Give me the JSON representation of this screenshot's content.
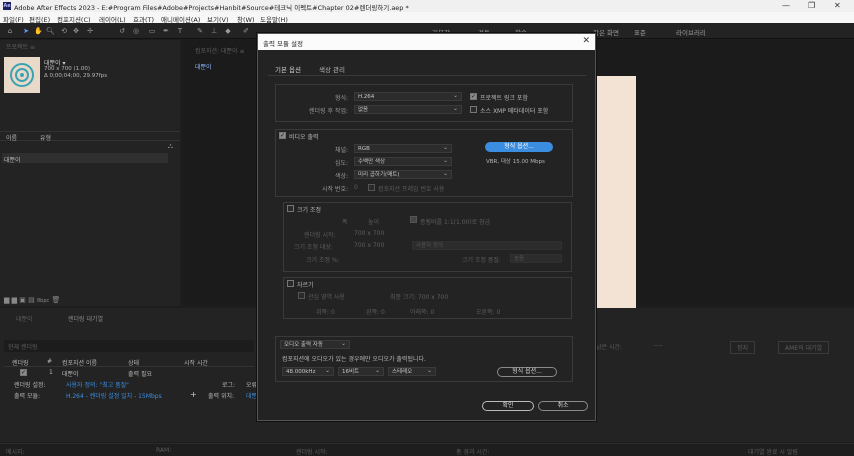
{
  "window": {
    "logo": "Ae",
    "title": "Adobe After Effects 2023 - E:#Program Files#Adobe#Projects#Hanbit#Source#테크닉 이펙트#Chapter 02#렌더링하기.aep *",
    "minimize": "—",
    "restore": "❐",
    "close": "✕"
  },
  "menu": [
    "파일(F)",
    "편집(E)",
    "컴포지션(C)",
    "레이어(L)",
    "효과(T)",
    "애니메이션(A)",
    "보기(V)",
    "창(W)",
    "도움말(H)"
  ],
  "workspaces": [
    "기본값",
    "검토",
    "학습",
    "작은 화면",
    "표준",
    "라이브러리"
  ],
  "project": {
    "header": "프로젝트 ≡",
    "comp_name": "대뿐이 ▾",
    "comp_size": "700 x 700 (1.00)",
    "comp_dur": "Δ 0;00;04;00, 29.97fps",
    "col_name": "이름",
    "col_type": "유형",
    "item": "대뿐이",
    "footer_bpc": "8bpc"
  },
  "comp_panel": {
    "header": "컴포지션: 대뿐이 ≡",
    "tab": "대뿐이"
  },
  "right_panel": {
    "estimate_label": "남은 시간:",
    "estimate_value": "----",
    "stop_btn": "정지",
    "queue_btn": "AME의 대기열"
  },
  "timeline": {
    "tab1": "대뿐이",
    "tab2": "렌더링 대기열",
    "search_label": "현재 렌더링",
    "col_render": "렌더링",
    "col_num": "#",
    "col_name": "컴포지션 이름",
    "col_status": "상태",
    "col_start": "시작 시간",
    "row_num": "1",
    "row_name": "대뿐이",
    "row_status": "출력 필요",
    "render_settings_label": "렌더링 설정:",
    "render_settings_value": "사용자 정의: \"최고 품질\"",
    "output_module_label": "출력 모듈:",
    "output_module_value": "H.264 - 렌더링 설정 일치 - 15Mbps",
    "log_label": "로그:",
    "log_value": "오류",
    "output_to_label": "출력 위치:",
    "output_to_value": "대뿐이"
  },
  "status_bar": {
    "messages": "메시지:",
    "ram": "RAM:",
    "renders_started": "렌더링 시작:",
    "total_time": "총 경과 시간:",
    "notify": "대기열 완료 시 알림"
  },
  "dialog": {
    "title": "출력 모듈 설정",
    "tabs": [
      "기본 옵션",
      "색상 관리"
    ],
    "format_label": "형식:",
    "format_value": "H.264",
    "post_render_label": "렌더링 후 작업:",
    "post_render_value": "없음",
    "include_project_link": "프로젝트 링크 포함",
    "include_xmp": "소스 XMP 메타데이터 포함",
    "video_output": "비디오 출력",
    "channels_label": "채널:",
    "channels_value": "RGB",
    "depth_label": "심도:",
    "depth_value": "수백만 색상",
    "color_label": "색상:",
    "color_value": "미리 곱하기(매트)",
    "start_label": "시작 번호:",
    "start_value": "0",
    "use_comp_frame": "컴포지션 프레임 번호 사용",
    "format_options_btn": "형식 옵션...",
    "format_info": "VBR, 대상 15.00 Mbps",
    "resize": "크기 조정",
    "resize_width": "폭",
    "resize_height": "높이",
    "lock_ratio": "종횡비를 1:1(1.00)로 잠금",
    "rendering_at_label": "렌더링 시작:",
    "rendering_at_value": "700 x 700",
    "resize_to_label": "크기 조정 대상:",
    "resize_to_value": "700 x 700",
    "resize_preset": "사용자 정의",
    "resize_pct_label": "크기 조정 %:",
    "resize_quality_label": "크기 조정 품질:",
    "resize_quality_value": "높음",
    "crop": "자르기",
    "use_roi": "관심 영역 사용",
    "final_size_label": "최종 크기: 700 x 700",
    "crop_top": "위쪽: 0",
    "crop_left": "왼쪽: 0",
    "crop_bottom": "아래쪽: 0",
    "crop_right": "오른쪽: 0",
    "audio_output": "오디오 출력 자동",
    "audio_note": "컴포지션에 오디오가 있는 경우에만 오디오가 출력됩니다.",
    "audio_rate": "48.000kHz",
    "audio_bits": "16비트",
    "audio_channels": "스테레오",
    "audio_format_btn": "형식 옵션...",
    "ok": "확인",
    "cancel": "취소"
  }
}
